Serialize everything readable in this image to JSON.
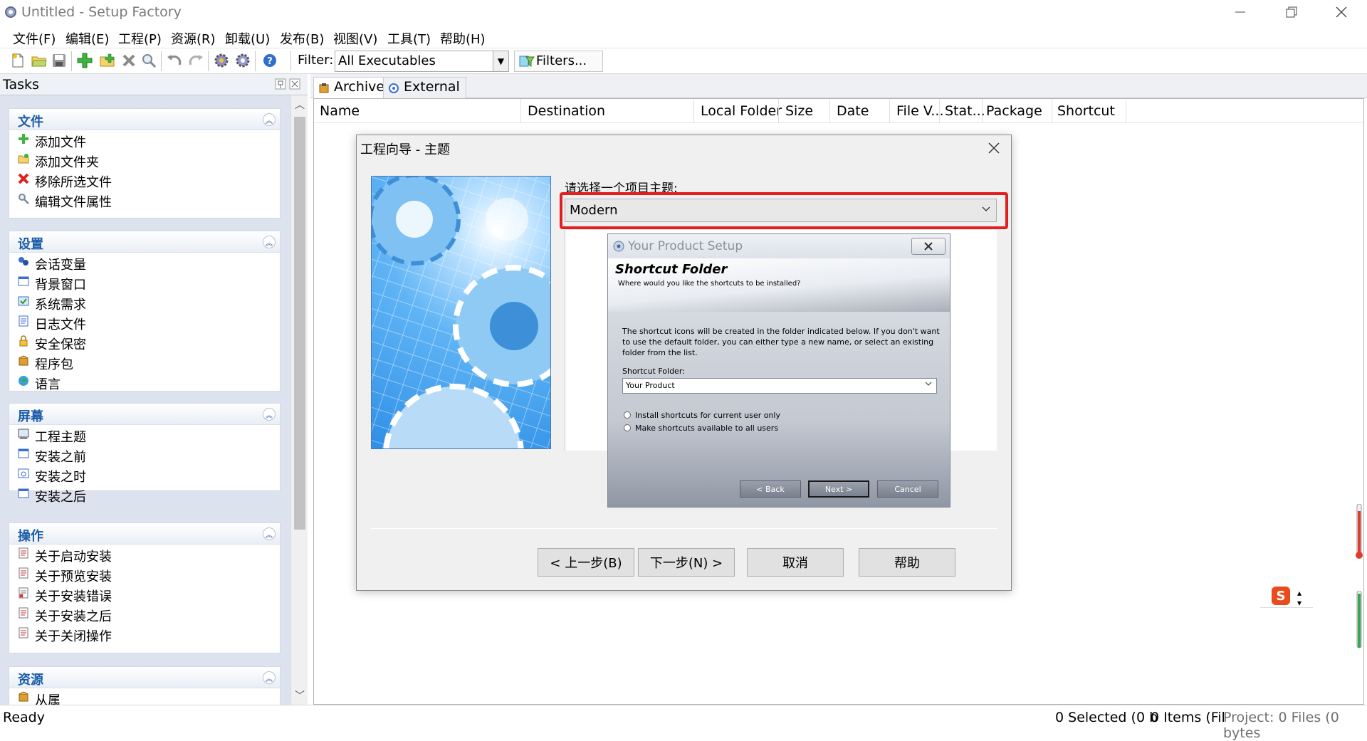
{
  "window": {
    "title": "Untitled - Setup Factory",
    "controls": [
      "minimize",
      "restore",
      "close"
    ]
  },
  "menu": [
    "文件(F)",
    "编辑(E)",
    "工程(P)",
    "资源(R)",
    "卸载(U)",
    "发布(B)",
    "视图(V)",
    "工具(T)",
    "帮助(H)"
  ],
  "toolbar": {
    "filter_label": "Filter:",
    "filter_value": "All Executables",
    "filters_button": "Filters..."
  },
  "tasks": {
    "title": "Tasks",
    "sections": [
      {
        "label": "文件",
        "items": [
          "添加文件",
          "添加文件夹",
          "移除所选文件",
          "编辑文件属性"
        ]
      },
      {
        "label": "设置",
        "items": [
          "会话变量",
          "背景窗口",
          "系统需求",
          "日志文件",
          "安全保密",
          "程序包",
          "语言"
        ]
      },
      {
        "label": "屏幕",
        "items": [
          "工程主题",
          "安装之前",
          "安装之时",
          "安装之后"
        ]
      },
      {
        "label": "操作",
        "items": [
          "关于启动安装",
          "关于预览安装",
          "关于安装错误",
          "关于安装之后",
          "关于关闭操作"
        ]
      },
      {
        "label": "资源",
        "items": [
          "从属"
        ]
      }
    ]
  },
  "main": {
    "tabs": [
      "Archive",
      "External"
    ],
    "columns": [
      "Name",
      "Destination",
      "Local Folder",
      "Size",
      "Date",
      "File V...",
      "Stat...",
      "Package",
      "Shortcut"
    ]
  },
  "wizard": {
    "title": "工程向导 - 主题",
    "theme_label": "请选择一个项目主题:",
    "theme_value": "Modern",
    "buttons": {
      "back": "< 上一步(B)",
      "next": "下一步(N) >",
      "cancel": "取消",
      "help": "帮助"
    }
  },
  "preview": {
    "title": "Your Product Setup",
    "heading": "Shortcut Folder",
    "subheading": "Where would you like the shortcuts to be installed?",
    "description": "The shortcut icons will be created in the folder indicated below. If you don't want to use the default folder, you can either type a new name, or select an existing folder from the list.",
    "folder_label": "Shortcut Folder:",
    "folder_value": "Your Product",
    "radio1": "Install shortcuts for current user only",
    "radio2": "Make shortcuts available to all users",
    "back": "< Back",
    "next": "Next >",
    "cancel": "Cancel"
  },
  "status": {
    "ready": "Ready",
    "selected": "0 Selected (0 b",
    "items": "0 Items (Fil",
    "project": "Project: 0 Files (0 bytes"
  }
}
